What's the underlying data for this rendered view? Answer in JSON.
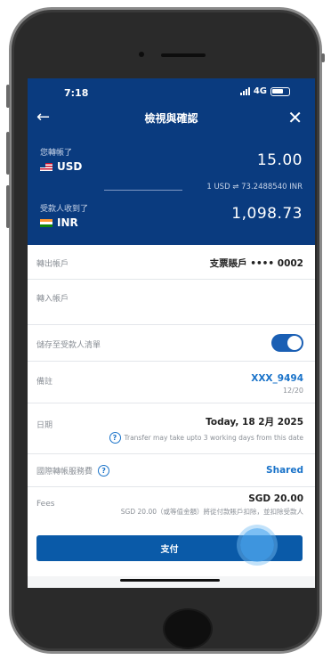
{
  "status": {
    "time": "7:18",
    "network": "4G"
  },
  "nav": {
    "back": "←",
    "title": "檢視與確認",
    "close": "✕"
  },
  "send": {
    "label": "您轉帳了",
    "currency": "USD",
    "amount": "15.00"
  },
  "rate": "1 USD ⇌ 73.2488540 INR",
  "receive": {
    "label": "受款人收到了",
    "currency": "INR",
    "amount": "1,098.73"
  },
  "rows": {
    "from_account": {
      "label": "轉出帳戶",
      "value": "支票賬戶 •••• 0002"
    },
    "to_account": {
      "label": "轉入帳戶"
    },
    "save_payee": {
      "label": "儲存至受款人清單",
      "on": true
    },
    "reference": {
      "label": "備註",
      "value": "XXX_9494",
      "count": "12/20"
    },
    "date": {
      "label": "日期",
      "value": "Today, 18 2月 2025",
      "note": "Transfer may take upto 3 working days from this date"
    },
    "charges": {
      "label": "國際轉帳服務費",
      "value": "Shared"
    },
    "fees": {
      "label": "Fees",
      "value": "SGD 20.00",
      "note": "SGD 20.00（或等值金額）將從付款賬戶扣除，並扣除受款人"
    }
  },
  "pay_label": "支付"
}
